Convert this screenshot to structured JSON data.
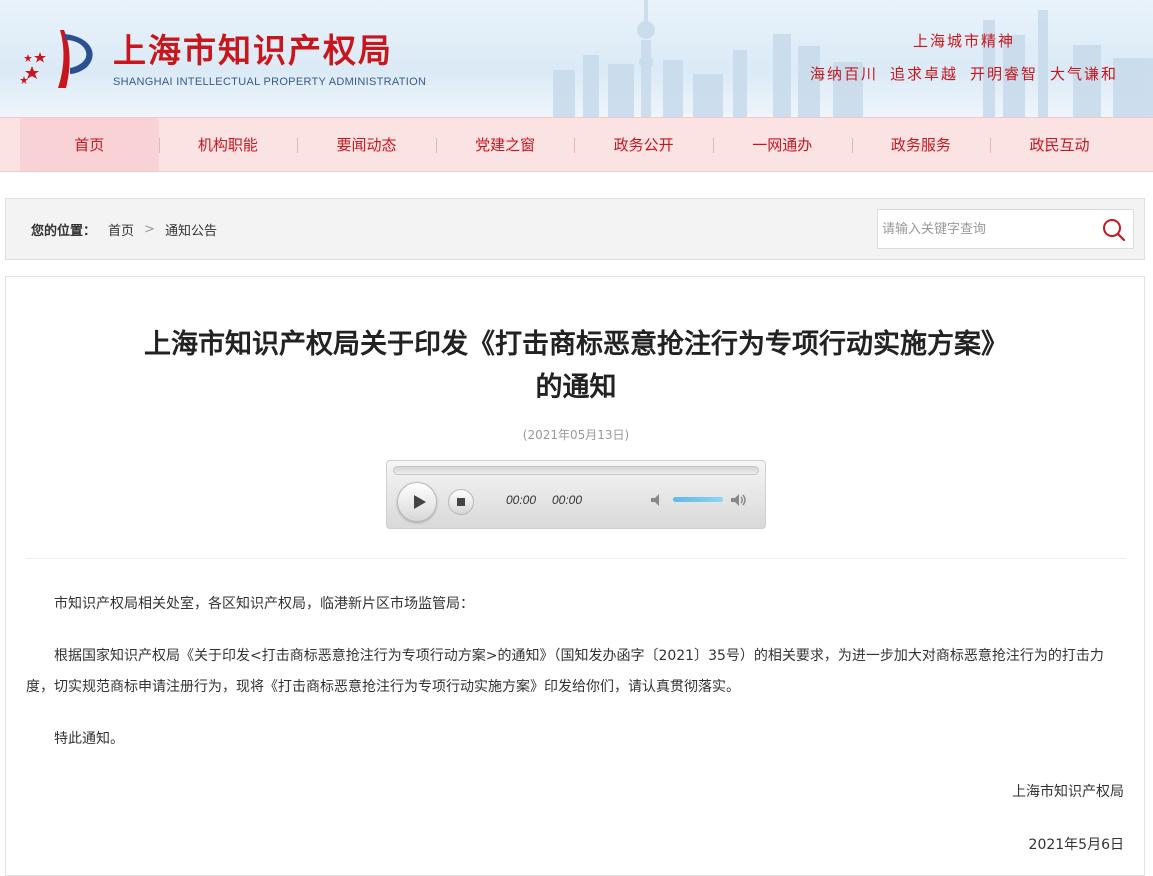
{
  "header": {
    "site_title": "上海市知识产权局",
    "site_subtitle": "SHANGHAI INTELLECTUAL PROPERTY ADMINISTRATION",
    "spirit_title": "上海城市精神",
    "spirit_items": [
      "海纳百川",
      "追求卓越",
      "开明睿智",
      "大气谦和"
    ],
    "brand_color": "#c8161d"
  },
  "nav": {
    "items": [
      {
        "label": "首页",
        "active": true
      },
      {
        "label": "机构职能"
      },
      {
        "label": "要闻动态"
      },
      {
        "label": "党建之窗"
      },
      {
        "label": "政务公开"
      },
      {
        "label": "一网通办"
      },
      {
        "label": "政务服务"
      },
      {
        "label": "政民互动"
      }
    ]
  },
  "breadcrumb": {
    "label": "您的位置：",
    "items": [
      "首页",
      "通知公告"
    ],
    "separator": ">"
  },
  "search": {
    "placeholder": "请输入关键字查询",
    "value": "",
    "icon": "search-icon"
  },
  "article": {
    "title": "上海市知识产权局关于印发《打击商标恶意抢注行为专项行动实施方案》的通知",
    "date": "(2021年05月13日)",
    "salutation": "市知识产权局相关处室，各区知识产权局，临港新片区市场监管局：",
    "paragraph": "根据国家知识产权局《关于印发<打击商标恶意抢注行为专项行动方案>的通知》（国知发办函字〔2021〕35号）的相关要求，为进一步加大对商标恶意抢注行为的打击力度，切实规范商标申请注册行为，现将《打击商标恶意抢注行为专项行动实施方案》印发给你们，请认真贯彻落实。",
    "closing": "特此通知。",
    "signature": "上海市知识产权局",
    "sign_date": "2021年5月6日"
  },
  "player": {
    "current_time": "00:00",
    "duration": "00:00",
    "progress": 0,
    "volume": 1.0
  }
}
